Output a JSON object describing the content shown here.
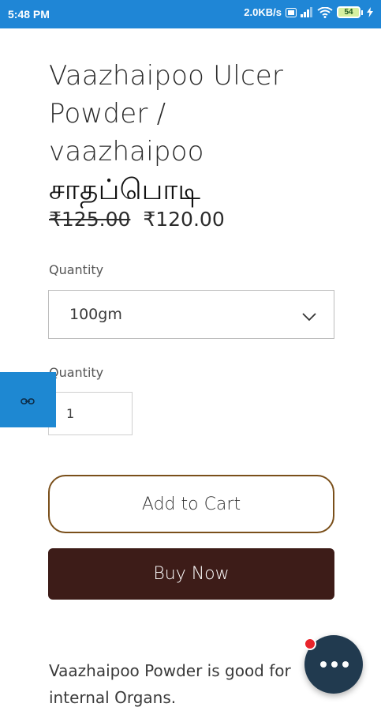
{
  "status_bar": {
    "time": "5:48 PM",
    "net_speed": "2.0KB/s",
    "battery_level": "54",
    "icons": [
      "volte-icon",
      "signal-icon",
      "wifi-icon",
      "battery-icon",
      "charging-icon"
    ]
  },
  "product": {
    "title_line1": "Vaazhaipoo Ulcer",
    "title_line2": "Powder /",
    "title_line3": "vaazhaipoo",
    "title_tamil": "சாதப்பொடி",
    "price_original": "₹125.00",
    "price_sale": "₹120.00"
  },
  "options": {
    "quantity_label": "Quantity",
    "selected_weight": "100gm"
  },
  "quantity": {
    "label": "Quantity",
    "value": "1"
  },
  "actions": {
    "add_to_cart": "Add to Cart",
    "buy_now": "Buy Now"
  },
  "description": {
    "line1": "Vaazhaipoo Powder is good for",
    "line2": "internal Organs."
  },
  "colors": {
    "status_bar": "#1f86d6",
    "buy_button": "#3d1c18",
    "cart_border": "#7a4f1a",
    "chat_fab": "#213a4f",
    "badge": "#e8242b"
  }
}
